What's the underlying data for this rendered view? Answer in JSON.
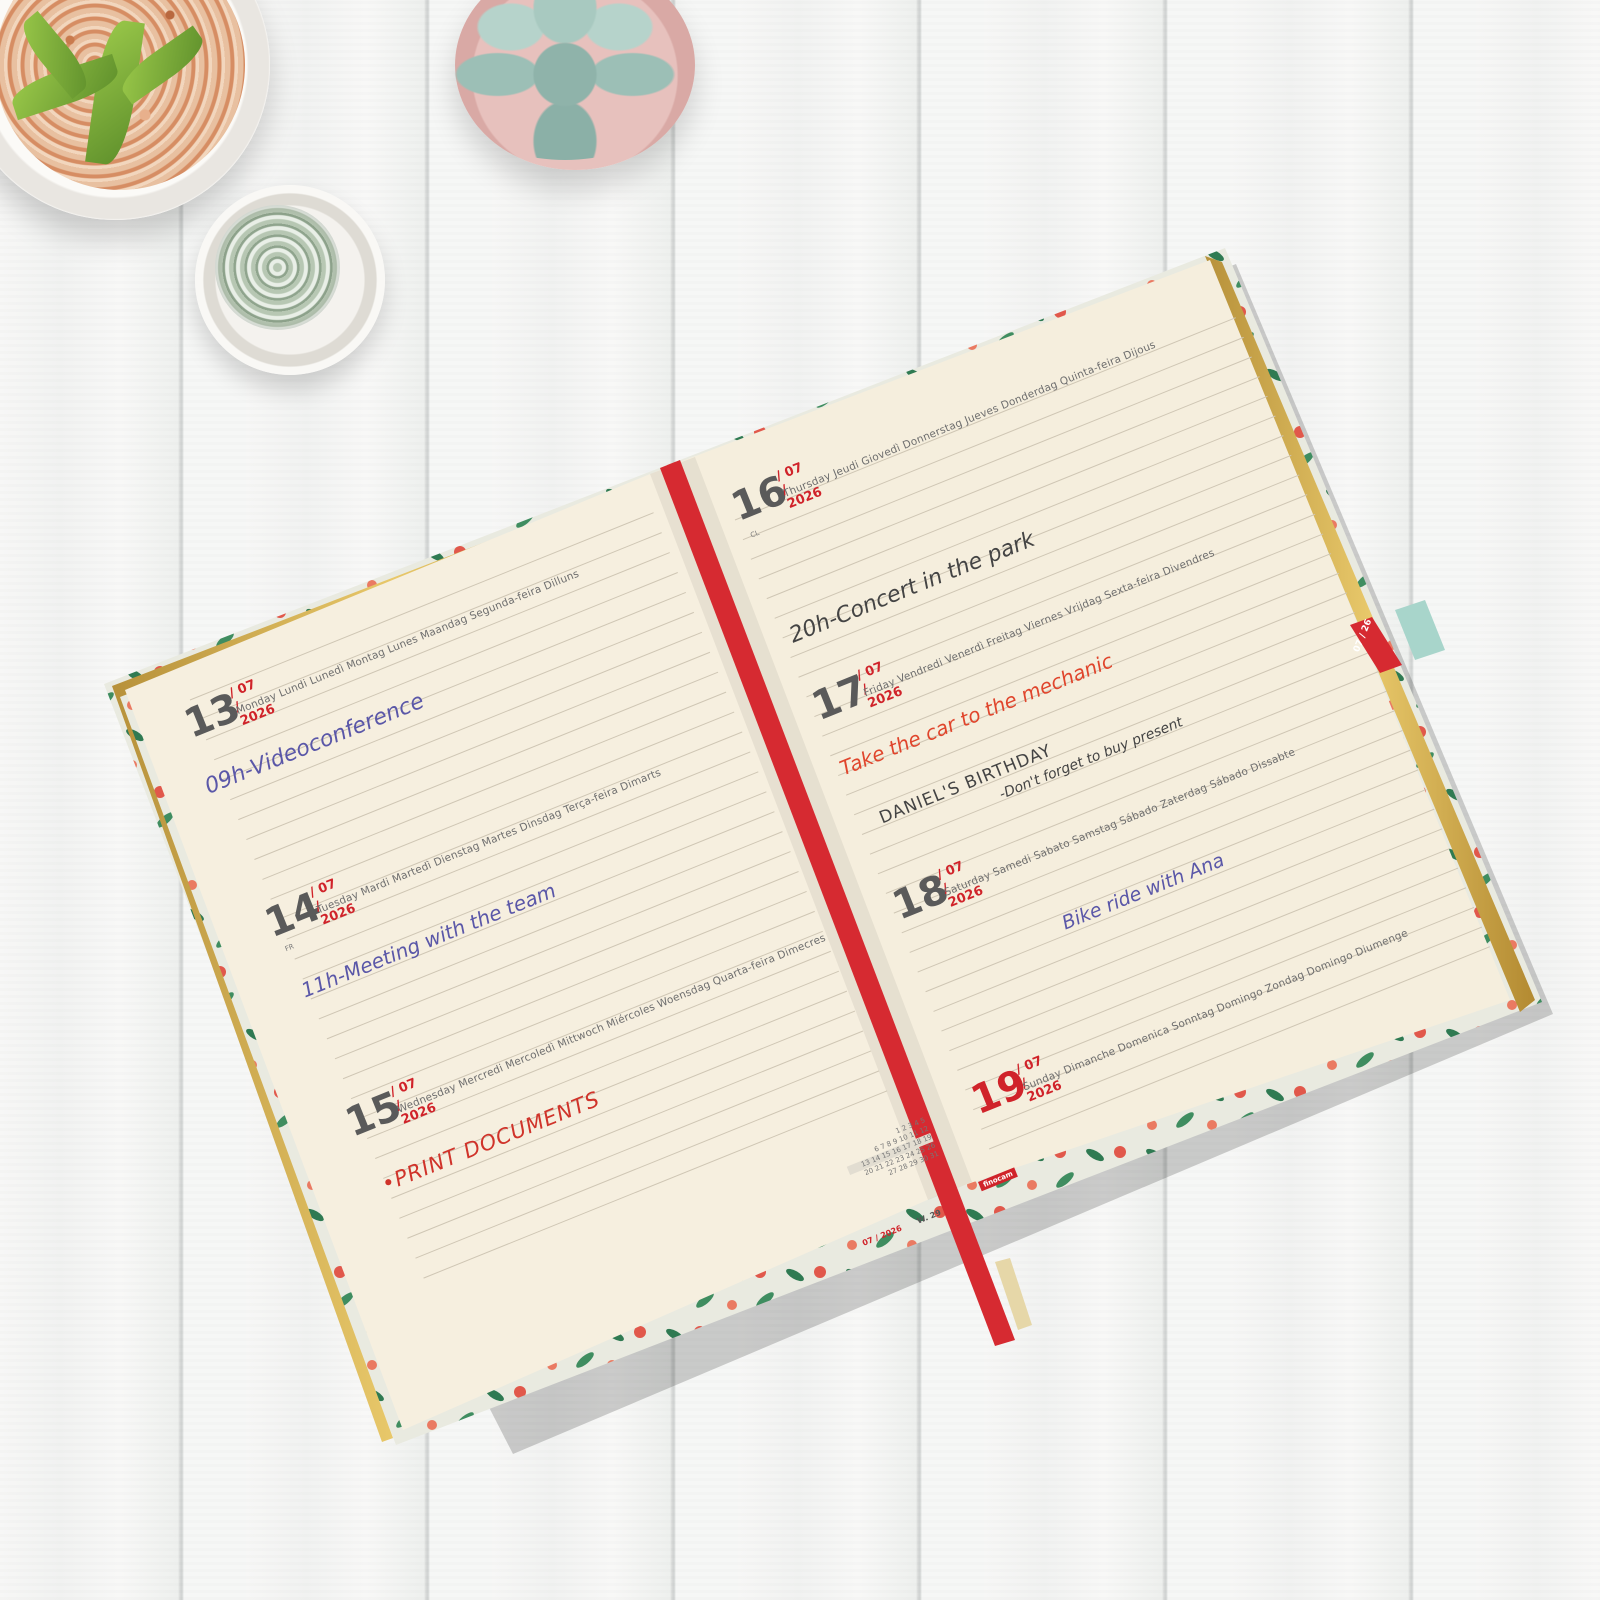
{
  "scene": {
    "description_items": [
      "white-planks",
      "gravel-pot",
      "cactus-pot",
      "succulent-pot",
      "open-planner"
    ]
  },
  "left_page": {
    "days": [
      {
        "num": "13",
        "date": "/ 07 / 2026",
        "names": "Monday  Lundi  Lunedì  Montag  Lunes  Maandag  Segunda-feira  Dilluns",
        "note": "09h-Videoconference",
        "note_color": "#5a57a8"
      },
      {
        "num": "14",
        "date": "/ 07 / 2026",
        "names": "Tuesday  Mardi  Martedì  Dienstag  Martes  Dinsdag  Terça-feira  Dimarts",
        "note": "11h-Meeting with the team",
        "note_color": "#5a57a8",
        "tag": "FR"
      },
      {
        "num": "15",
        "date": "/ 07 / 2026",
        "names": "Wednesday  Mercredi  Mercoledì  Mittwoch  Miércoles  Woensdag  Quarta-feira  Dimecres",
        "note": "•PRINT DOCUMENTS",
        "note_color": "#d0332a"
      }
    ],
    "mini_calendar": {
      "label": "07 / 2026",
      "week": "W. 29",
      "rows": [
        "1 2 3 4 5",
        "6 7 8 9 10 11 12",
        "13 14 15 16 17 18 19",
        "20 21 22 23 24 25 26",
        "27 28 29 30 31"
      ]
    }
  },
  "right_page": {
    "days": [
      {
        "num": "16",
        "date": "/ 07 / 2026",
        "names": "Thursday  Jeudi  Giovedì  Donnerstag  Jueves  Donderdag  Quinta-feira  Dijous",
        "note": "20h-Concert in the park",
        "note_color": "#444444",
        "tag": "CL"
      },
      {
        "num": "17",
        "date": "/ 07 / 2026",
        "names": "Friday  Vendredi  Venerdì  Freitag  Viernes  Vrijdag  Sexta-feira  Divendres",
        "note": "Take the car to the mechanic",
        "note_color": "#e0452c",
        "extra1": "DANIEL'S BIRTHDAY",
        "extra2": "-Don't forget to buy present"
      },
      {
        "num": "18",
        "date": "/ 07 / 2026",
        "names": "Saturday  Samedi  Sabato  Samstag  Sábado  Zaterdag  Sábado  Dissabte",
        "note": "Bike ride with Ana",
        "note_color": "#5a57a8"
      },
      {
        "num": "19",
        "date": "/ 07 / 2026",
        "names": "Sunday  Dimanche  Domenica  Sonntag  Domingo  Zondag  Domingo  Diumenge",
        "note": "",
        "note_color": "#444444"
      }
    ],
    "month_tab": "07 / 26",
    "brand": "finocam"
  }
}
